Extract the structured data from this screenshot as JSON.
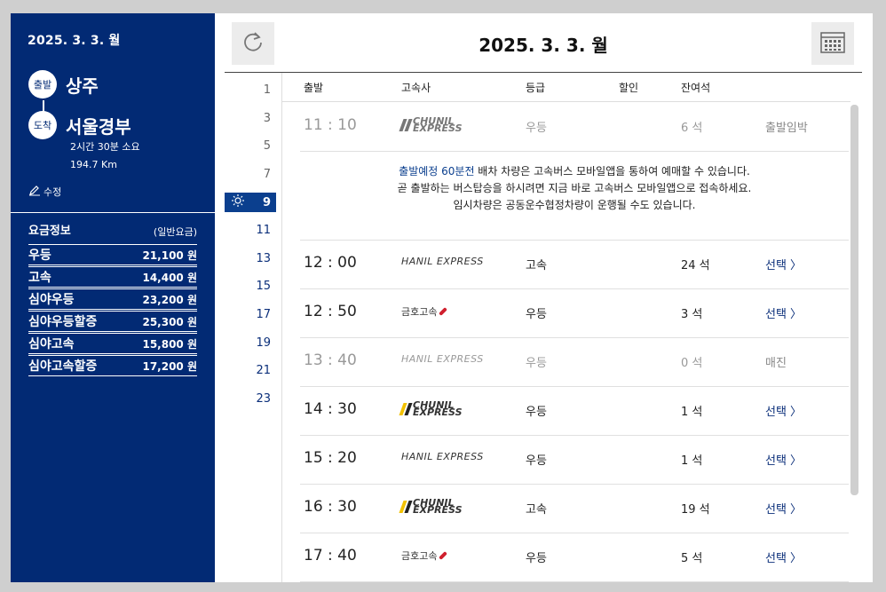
{
  "colors": {
    "primary": "#022a74",
    "accent": "#0b3f8e",
    "red": "#d0202e",
    "chunil_yellow": "#f2c100"
  },
  "sidebar": {
    "date": "2025. 3. 3. 월",
    "departure": {
      "badge": "출발",
      "name": "상주"
    },
    "arrival": {
      "badge": "도착",
      "name": "서울경부"
    },
    "duration": "2시간 30분 소요",
    "distance": "194.7 Km",
    "edit_label": "수정",
    "fare_title": "요금정보",
    "fare_type": "(일반요금)",
    "fares": [
      {
        "name": "우등",
        "price": "21,100 원"
      },
      {
        "name": "고속",
        "price": "14,400 원"
      },
      {
        "name": "심야우등",
        "price": "23,200 원"
      },
      {
        "name": "심야우등할증",
        "price": "25,300 원"
      },
      {
        "name": "심야고속",
        "price": "15,800 원"
      },
      {
        "name": "심야고속할증",
        "price": "17,200 원"
      }
    ]
  },
  "header": {
    "title": "2025. 3. 3. 월",
    "refresh_icon": "refresh-icon",
    "calendar_icon": "calendar-icon"
  },
  "hours": [
    "1",
    "3",
    "5",
    "7",
    "9",
    "11",
    "13",
    "15",
    "17",
    "19",
    "21",
    "23"
  ],
  "active_hour": "9",
  "columns": {
    "departure": "출발",
    "company": "고속사",
    "grade": "등급",
    "discount": "할인",
    "seats": "잔여석"
  },
  "notice": {
    "highlight": "출발예정 60분전",
    "line1_rest": " 배차 차량은 고속버스 모바일앱을 통하여 예매할 수 있습니다.",
    "line2": "곧 출발하는 버스탑승을 하시려면 지금 바로 고속버스 모바일앱으로 접속하세요.",
    "line3": "임시차량은 공동운수협정차량이 운행될 수도 있습니다."
  },
  "rows": [
    {
      "time": "11 : 10",
      "company": "CHUNIL EXPRESS",
      "grade": "우등",
      "seats": "6 석",
      "status": "출발임박"
    },
    {
      "time": "12 : 00",
      "company": "HANIL EXPRESS",
      "grade": "고속",
      "seats": "24 석",
      "status": "선택 〉"
    },
    {
      "time": "12 : 50",
      "company": "금호고속",
      "grade": "우등",
      "seats": "3 석",
      "status": "선택 〉"
    },
    {
      "time": "13 : 40",
      "company": "HANIL EXPRESS",
      "grade": "우등",
      "seats": "0 석",
      "status": "매진"
    },
    {
      "time": "14 : 30",
      "company": "CHUNIL EXPRESS",
      "grade": "우등",
      "seats": "1 석",
      "status": "선택 〉"
    },
    {
      "time": "15 : 20",
      "company": "HANIL EXPRESS",
      "grade": "우등",
      "seats": "1 석",
      "status": "선택 〉"
    },
    {
      "time": "16 : 30",
      "company": "CHUNIL EXPRESS",
      "grade": "고속",
      "seats": "19 석",
      "status": "선택 〉"
    },
    {
      "time": "17 : 40",
      "company": "금호고속",
      "grade": "우등",
      "seats": "5 석",
      "status": "선택 〉"
    }
  ]
}
